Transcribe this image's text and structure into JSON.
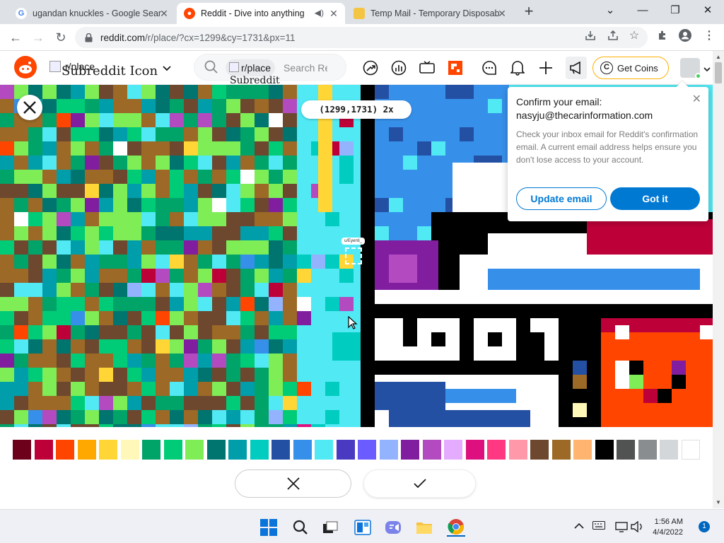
{
  "browser": {
    "tabs": [
      {
        "title": "ugandan knuckles - Google Sear",
        "active": false
      },
      {
        "title": "Reddit - Dive into anything",
        "active": true
      },
      {
        "title": "Temp Mail - Temporary Disposab",
        "active": false
      }
    ],
    "url_host": "reddit.com",
    "url_rest": "/r/place/?cx=1299&cy=1731&px=11"
  },
  "header": {
    "subreddit_img_alt": "Subreddit Icon",
    "subreddit_name": "r/place",
    "search_chip": "r/place",
    "search_chip_alt": "Subreddit\nIcon",
    "search_placeholder": "Search Re",
    "coins_label": "Get Coins"
  },
  "canvas": {
    "coord_label": "(1299,1731) 2x",
    "user_tag": "u/Eyenti_"
  },
  "email_popup": {
    "title": "Confirm your email:",
    "email": "nasyju@thecarinformation.com",
    "body": "Check your inbox email for Reddit's confirmation email. A current email address helps ensure you don't lose access to your account.",
    "update_label": "Update email",
    "gotit_label": "Got it"
  },
  "palette": {
    "colors": [
      "#6d001a",
      "#be0039",
      "#ff4500",
      "#ffa800",
      "#ffd635",
      "#fff8b8",
      "#00a368",
      "#00cc78",
      "#7eed56",
      "#00756f",
      "#009eaa",
      "#00ccc0",
      "#2450a4",
      "#3690ea",
      "#51e9f4",
      "#493ac1",
      "#6a5cff",
      "#94b3ff",
      "#811e9f",
      "#b44ac0",
      "#e4abff",
      "#de107f",
      "#ff3881",
      "#ff99aa",
      "#6d482f",
      "#9c6926",
      "#ffb470",
      "#000000",
      "#515252",
      "#898d90",
      "#d4d7d9",
      "#ffffff"
    ]
  },
  "taskbar": {
    "time": "1:56 AM",
    "date": "4/4/2022",
    "notifications": "1"
  }
}
